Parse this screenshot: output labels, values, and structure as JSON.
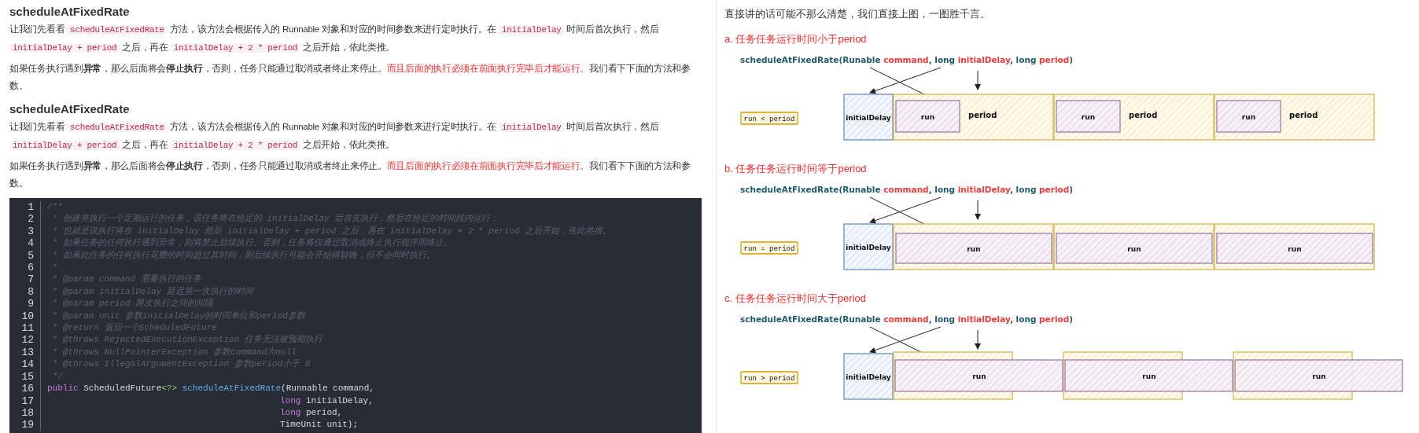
{
  "left": {
    "sections": [
      {
        "title": "scheduleAtFixedRate",
        "paragraphs": [
          [
            {
              "kind": "text",
              "text": "让我们先看看 "
            },
            {
              "kind": "code",
              "text": "scheduleAtFixedRate"
            },
            {
              "kind": "text",
              "text": " 方法，该方法会根据传入的 Runnable 对象和对应的时间参数来进行定时执行。在 "
            },
            {
              "kind": "code",
              "text": "initialDelay"
            },
            {
              "kind": "text",
              "text": " 时间后首次执行，然后 "
            },
            {
              "kind": "code",
              "text": "initialDelay + period"
            },
            {
              "kind": "text",
              "text": " 之后，再在 "
            },
            {
              "kind": "code",
              "text": "initialDelay + 2 * period"
            },
            {
              "kind": "text",
              "text": " 之后开始，依此类推。"
            }
          ],
          [
            {
              "kind": "text",
              "text": "如果任务执行遇到**异常**，那么后面将会**停止执行**，否则，任务只能通过取消或者终止来停止。"
            },
            {
              "kind": "alert",
              "text": "而且后面的执行必须在前面执行完毕后才能运行。"
            },
            {
              "kind": "text",
              "text": "我们看下下面的方法和参数。"
            }
          ]
        ]
      },
      {
        "title": "scheduleAtFixedRate",
        "paragraphs": [
          [
            {
              "kind": "text",
              "text": "让我们先看看 "
            },
            {
              "kind": "code",
              "text": "scheduleAtFixedRate"
            },
            {
              "kind": "text",
              "text": " 方法，该方法会根据传入的 Runnable 对象和对应的时间参数来进行定时执行。在 "
            },
            {
              "kind": "code",
              "text": "initialDelay"
            },
            {
              "kind": "text",
              "text": " 时间后首次执行，然后 "
            },
            {
              "kind": "code",
              "text": "initialDelay + period"
            },
            {
              "kind": "text",
              "text": " 之后，再在 "
            },
            {
              "kind": "code",
              "text": "initialDelay + 2 * period"
            },
            {
              "kind": "text",
              "text": " 之后开始，依此类推。"
            }
          ],
          [
            {
              "kind": "text",
              "text": "如果任务执行遇到**异常**，那么后面将会**停止执行**，否则，任务只能通过取消或者终止来停止。"
            },
            {
              "kind": "alert",
              "text": "而且后面的执行必须在前面执行完毕后才能运行。"
            },
            {
              "kind": "text",
              "text": "我们看下下面的方法和参数。"
            }
          ]
        ]
      }
    ],
    "code": {
      "lines": [
        {
          "number": "1",
          "segments": [
            {
              "kind": "comment",
              "text": "/**"
            }
          ]
        },
        {
          "number": "2",
          "segments": [
            {
              "kind": "comment",
              "text": " * 创建并执行一个定期运行的任务，该任务将在给定的 initialDelay 后首先执行，然后在给定的时间段内运行；"
            }
          ]
        },
        {
          "number": "3",
          "segments": [
            {
              "kind": "comment",
              "text": " * 也就是说执行将在 initialDelay 然后 initialDelay + period 之后，再在 initialDelay + 2 * period 之后开始，依此类推。"
            }
          ]
        },
        {
          "number": "4",
          "segments": [
            {
              "kind": "comment",
              "text": " * 如果任务的任何执行遇到异常，则将禁止后续执行。否则，任务将仅通过取消或终止执行程序而终止。"
            }
          ]
        },
        {
          "number": "5",
          "segments": [
            {
              "kind": "comment",
              "text": " * 如果此任务的任何执行花费的时间超过其时间，则后续执行可能会开始得较晚，但不会同时执行。"
            }
          ]
        },
        {
          "number": "6",
          "segments": [
            {
              "kind": "comment",
              "text": " *"
            }
          ]
        },
        {
          "number": "7",
          "segments": [
            {
              "kind": "comment",
              "text": " * @param command 需要执行的任务"
            }
          ]
        },
        {
          "number": "8",
          "segments": [
            {
              "kind": "comment",
              "text": " * @param initialDelay 延迟第一次执行的时间"
            }
          ]
        },
        {
          "number": "9",
          "segments": [
            {
              "kind": "comment",
              "text": " * @param period 两次执行之间的间隔"
            }
          ]
        },
        {
          "number": "10",
          "segments": [
            {
              "kind": "comment",
              "text": " * @param unit 参数initialDelay的时间单位和period参数"
            }
          ]
        },
        {
          "number": "11",
          "segments": [
            {
              "kind": "comment",
              "text": " * @return 返回一个ScheduledFuture"
            }
          ]
        },
        {
          "number": "12",
          "segments": [
            {
              "kind": "comment",
              "text": " * @throws RejectedExecutionException 任务无法被预期执行"
            }
          ]
        },
        {
          "number": "13",
          "segments": [
            {
              "kind": "comment",
              "text": " * @throws NullPointerException 参数command为null"
            }
          ]
        },
        {
          "number": "14",
          "segments": [
            {
              "kind": "comment",
              "text": " * @throws IllegalArgumentException 参数period小于 0"
            }
          ]
        },
        {
          "number": "15",
          "segments": [
            {
              "kind": "comment",
              "text": " */"
            }
          ]
        },
        {
          "number": "16",
          "segments": [
            {
              "kind": "keyword",
              "text": "public"
            },
            {
              "kind": "plain",
              "text": " ScheduledFuture"
            },
            {
              "kind": "generic",
              "text": "<?>"
            },
            {
              "kind": "function",
              "text": " scheduleAtFixedRate"
            },
            {
              "kind": "plain",
              "text": "(Runnable command,"
            }
          ]
        },
        {
          "number": "17",
          "aligned": true,
          "segments": [
            {
              "kind": "keyword",
              "text": "long"
            },
            {
              "kind": "plain",
              "text": " initialDelay,"
            }
          ]
        },
        {
          "number": "18",
          "aligned": true,
          "segments": [
            {
              "kind": "keyword",
              "text": "long"
            },
            {
              "kind": "plain",
              "text": " period,"
            }
          ]
        },
        {
          "number": "19",
          "aligned": true,
          "segments": [
            {
              "kind": "plain",
              "text": "TimeUnit unit);"
            }
          ]
        }
      ]
    }
  },
  "right": {
    "intro": "直接讲的话可能不那么清楚，我们直接上图，一图胜千言。",
    "diagrams": [
      {
        "heading": "a. 任务任务运行时间小于period",
        "kind": "lt",
        "signature": [
          {
            "kind": "plain",
            "text": "scheduleAtFixedRate(Runable "
          },
          {
            "kind": "param",
            "text": "command"
          },
          {
            "kind": "plain",
            "text": ", long "
          },
          {
            "kind": "param",
            "text": "initialDelay"
          },
          {
            "kind": "plain",
            "text": ", long "
          },
          {
            "kind": "param",
            "text": "period"
          },
          {
            "kind": "plain",
            "text": ")"
          }
        ],
        "legend": "run < period",
        "initial_delay": "initialDelay",
        "periods": [
          {
            "run": "run",
            "period": "period"
          },
          {
            "run": "run",
            "period": "period"
          },
          {
            "run": "run",
            "period": "period"
          }
        ]
      },
      {
        "heading": "b. 任务任务运行时间等于period",
        "kind": "eq",
        "signature": [
          {
            "kind": "plain",
            "text": "scheduleAtFixedRate(Runable "
          },
          {
            "kind": "param",
            "text": "command"
          },
          {
            "kind": "plain",
            "text": ", long "
          },
          {
            "kind": "param",
            "text": "initialDelay"
          },
          {
            "kind": "plain",
            "text": ", long "
          },
          {
            "kind": "param",
            "text": "period"
          },
          {
            "kind": "plain",
            "text": ")"
          }
        ],
        "legend": "run = period",
        "initial_delay": "initialDelay",
        "periods": [
          {
            "run": "run"
          },
          {
            "run": "run"
          },
          {
            "run": "run"
          }
        ]
      },
      {
        "heading": "c. 任务任务运行时间大于period",
        "kind": "gt",
        "signature": [
          {
            "kind": "plain",
            "text": "scheduleAtFixedRate(Runable "
          },
          {
            "kind": "param",
            "text": "command"
          },
          {
            "kind": "plain",
            "text": ", long "
          },
          {
            "kind": "param",
            "text": "initialDelay"
          },
          {
            "kind": "plain",
            "text": ", long "
          },
          {
            "kind": "param",
            "text": "period"
          },
          {
            "kind": "plain",
            "text": ")"
          }
        ],
        "legend": "run > period",
        "initial_delay": "initialDelay",
        "periods": [
          {
            "run": "run"
          },
          {
            "run": "run"
          },
          {
            "run": "run"
          }
        ]
      }
    ]
  }
}
